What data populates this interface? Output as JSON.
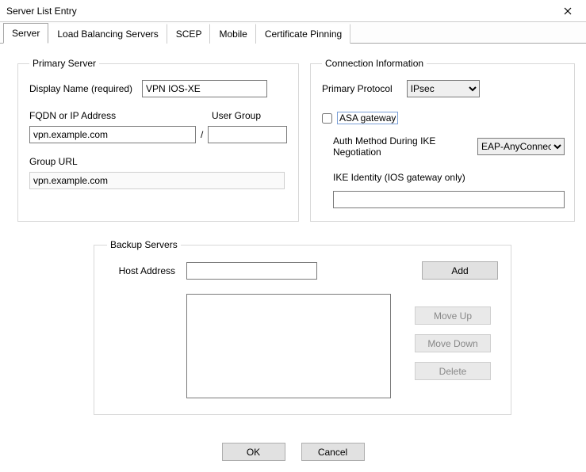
{
  "window": {
    "title": "Server List Entry"
  },
  "tabs": {
    "server": "Server",
    "load_balancing": "Load Balancing Servers",
    "scep": "SCEP",
    "mobile": "Mobile",
    "cert_pinning": "Certificate Pinning"
  },
  "primary_server": {
    "legend": "Primary Server",
    "display_name_label": "Display Name (required)",
    "display_name_value": "VPN IOS-XE",
    "fqdn_label": "FQDN or IP Address",
    "user_group_label": "User Group",
    "fqdn_value": "vpn.example.com",
    "user_group_value": "",
    "slash": "/",
    "group_url_label": "Group URL",
    "group_url_value": "vpn.example.com"
  },
  "conn_info": {
    "legend": "Connection Information",
    "primary_protocol_label": "Primary Protocol",
    "primary_protocol_value": "IPsec",
    "asa_gateway_label": "ASA gateway",
    "asa_gateway_checked": false,
    "auth_method_label": "Auth Method During IKE Negotiation",
    "auth_method_value": "EAP-AnyConnect",
    "ike_identity_label": "IKE Identity (IOS gateway only)",
    "ike_identity_value": ""
  },
  "backup": {
    "legend": "Backup Servers",
    "host_label": "Host Address",
    "host_value": "",
    "add_label": "Add",
    "move_up_label": "Move Up",
    "move_down_label": "Move Down",
    "delete_label": "Delete"
  },
  "buttons": {
    "ok": "OK",
    "cancel": "Cancel"
  }
}
